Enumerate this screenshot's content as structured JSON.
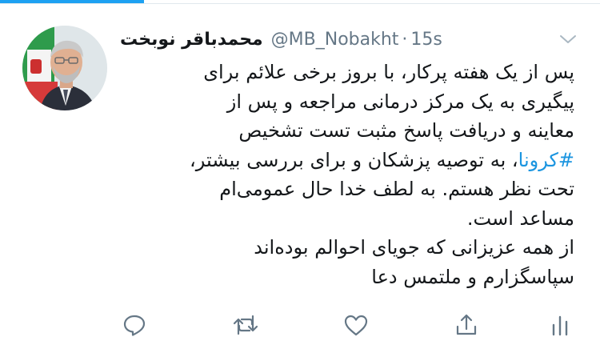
{
  "author": {
    "display_name": "محمدباقر نوبخت",
    "handle": "@MB_Nobakht",
    "separator": "·",
    "time": "15s"
  },
  "tweet": {
    "line1": "پس از یک هفته پرکار، با بروز برخی علائم برای",
    "line2": "پیگیری به یک مرکز درمانی مراجعه و پس از",
    "line3": "معاینه و دریافت پاسخ مثبت تست تشخیص",
    "hashtag": "#کرونا",
    "line4_rest": "، به توصیه پزشکان و برای بررسی بیشتر،",
    "line5": "تحت نظر هستم. به لطف خدا حال عمومی‌ام",
    "line6": "مساعد است.",
    "line7": "از همه عزیزانی که جویای احوالم بوده‌اند",
    "line8": "سپاسگزارم و ملتمس دعا"
  },
  "icons": {
    "menu": "chevron-down-icon",
    "reply": "reply-icon",
    "retweet": "retweet-icon",
    "like": "heart-icon",
    "share": "share-icon",
    "analytics": "analytics-icon"
  },
  "colors": {
    "accent": "#1da1f2",
    "hashtag": "#1b95e0",
    "secondary_text": "#657786",
    "icon": "#657786"
  }
}
